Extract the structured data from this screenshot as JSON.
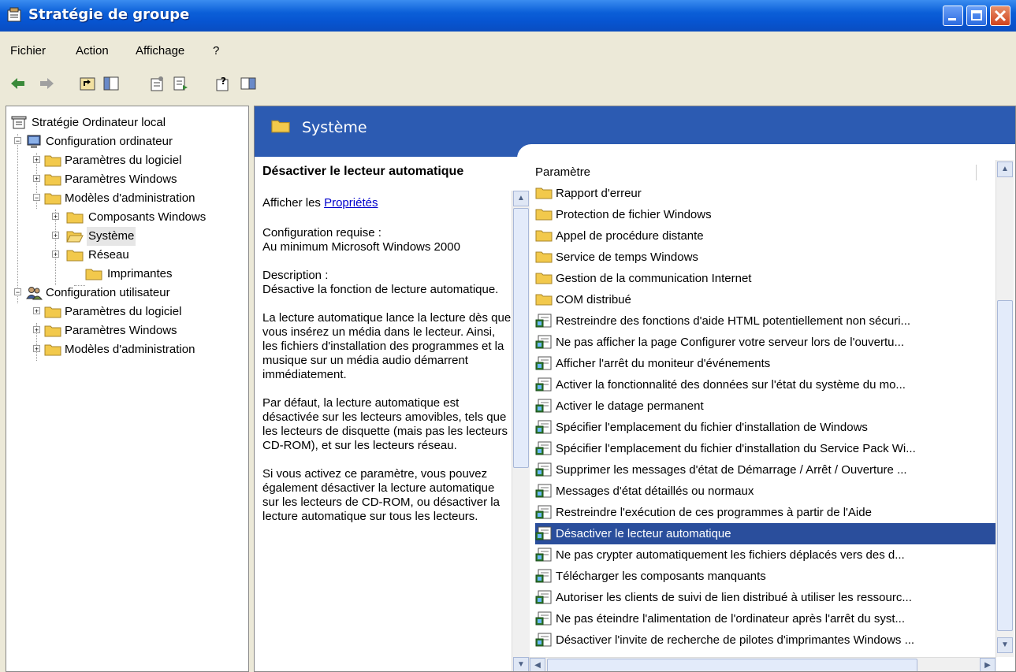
{
  "window": {
    "title": "Stratégie de groupe"
  },
  "menu": [
    {
      "label": "Fichier"
    },
    {
      "label": "Action"
    },
    {
      "label": "Affichage"
    },
    {
      "label": "?"
    }
  ],
  "toolbar": {
    "icons": [
      "back-arrow-icon",
      "forward-arrow-icon",
      "up-folder-icon",
      "show-hide-tree-icon",
      "properties-icon",
      "export-list-icon",
      "help-icon",
      "action-pane-icon"
    ]
  },
  "tree": {
    "items": [
      {
        "label": "Stratégie Ordinateur local",
        "icon": "policy-scroll-icon"
      },
      {
        "label": "Configuration ordinateur",
        "icon": "computer-icon"
      },
      {
        "label": "Paramètres du logiciel",
        "icon": "folder-icon"
      },
      {
        "label": "Paramètres Windows",
        "icon": "folder-icon"
      },
      {
        "label": "Modèles d'administration",
        "icon": "folder-icon"
      },
      {
        "label": "Composants Windows",
        "icon": "folder-icon"
      },
      {
        "label": "Système",
        "icon": "folder-open-icon",
        "selected": true
      },
      {
        "label": "Réseau",
        "icon": "folder-icon"
      },
      {
        "label": "Imprimantes",
        "icon": "folder-icon"
      },
      {
        "label": "Configuration utilisateur",
        "icon": "users-icon"
      },
      {
        "label": "Paramètres du logiciel",
        "icon": "folder-icon"
      },
      {
        "label": "Paramètres Windows",
        "icon": "folder-icon"
      },
      {
        "label": "Modèles d'administration",
        "icon": "folder-icon"
      }
    ]
  },
  "header": {
    "title": "Système"
  },
  "description": {
    "heading": "Désactiver le lecteur automatique",
    "show_prefix": "Afficher les ",
    "properties_link": "Propriétés",
    "req_label": "Configuration requise :",
    "req_value": "Au minimum Microsoft Windows 2000",
    "desc_label": "Description :",
    "desc_value": "Désactive la fonction de lecture automatique.",
    "para1": "La lecture automatique lance la lecture dès que vous insérez un média dans le lecteur. Ainsi, les fichiers d'installation des programmes et la musique sur un média audio démarrent immédiatement.",
    "para2": "Par défaut, la lecture automatique est désactivée sur les lecteurs amovibles, tels que les lecteurs de disquette (mais pas les lecteurs CD-ROM), et sur les lecteurs réseau.",
    "para3": "Si vous activez ce paramètre, vous pouvez également désactiver la lecture automatique sur les lecteurs de CD-ROM, ou désactiver la lecture automatique sur tous les lecteurs."
  },
  "list": {
    "column": "Paramètre",
    "rows": [
      {
        "label": "Rapport d'erreur",
        "icon": "folder-icon"
      },
      {
        "label": "Protection de fichier Windows",
        "icon": "folder-icon"
      },
      {
        "label": "Appel de procédure distante",
        "icon": "folder-icon"
      },
      {
        "label": "Service de temps Windows",
        "icon": "folder-icon"
      },
      {
        "label": "Gestion de la communication Internet",
        "icon": "folder-icon"
      },
      {
        "label": "COM distribué",
        "icon": "folder-icon"
      },
      {
        "label": "Restreindre des fonctions d'aide HTML potentiellement non sécuri...",
        "icon": "setting-icon"
      },
      {
        "label": "Ne pas afficher la page Configurer votre serveur lors de l'ouvertu...",
        "icon": "setting-icon"
      },
      {
        "label": "Afficher l'arrêt du moniteur d'événements",
        "icon": "setting-icon"
      },
      {
        "label": "Activer la fonctionnalité des données sur l'état du système du mo...",
        "icon": "setting-icon"
      },
      {
        "label": "Activer le datage permanent",
        "icon": "setting-icon"
      },
      {
        "label": "Spécifier l'emplacement du fichier d'installation de Windows",
        "icon": "setting-icon"
      },
      {
        "label": "Spécifier l'emplacement du fichier d'installation du Service Pack Wi...",
        "icon": "setting-icon"
      },
      {
        "label": "Supprimer les messages d'état de Démarrage / Arrêt / Ouverture ...",
        "icon": "setting-icon"
      },
      {
        "label": "Messages d'état détaillés ou normaux",
        "icon": "setting-icon"
      },
      {
        "label": "Restreindre l'exécution de ces programmes à partir de l'Aide",
        "icon": "setting-icon"
      },
      {
        "label": "Désactiver le lecteur automatique",
        "icon": "setting-icon",
        "selected": true
      },
      {
        "label": "Ne pas crypter automatiquement les fichiers déplacés vers des d...",
        "icon": "setting-icon"
      },
      {
        "label": "Télécharger les composants manquants",
        "icon": "setting-icon"
      },
      {
        "label": "Autoriser les clients de suivi de lien distribué à utiliser les ressourc...",
        "icon": "setting-icon"
      },
      {
        "label": "Ne pas éteindre l'alimentation de l'ordinateur après l'arrêt du syst...",
        "icon": "setting-icon"
      },
      {
        "label": "Désactiver l'invite de recherche de pilotes d'imprimantes Windows ...",
        "icon": "setting-icon"
      }
    ]
  },
  "colors": {
    "title_bar": "#0754d0",
    "header_band": "#2c5bb2",
    "selection": "#2a4e9c",
    "folder": "#f2c94c"
  }
}
